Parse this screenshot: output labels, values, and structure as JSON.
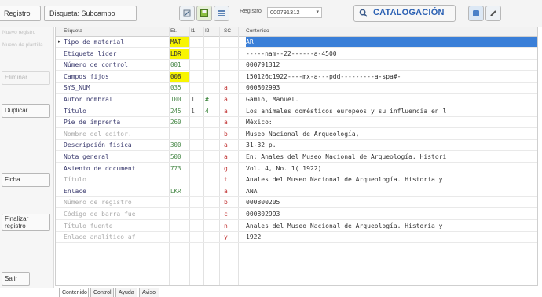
{
  "toolbar": {
    "registro_label": "Registro",
    "disquette_label": "Disqueta: Subcampo",
    "registro_select_label": "Registro",
    "registro_value": "000791312",
    "catalog_label": "CATALOGACIÓN"
  },
  "sidebar": {
    "nuevo_label": "Nuevo registro",
    "nuevo_de_label": "Nuevo de plantilla",
    "eliminar_label": "Eliminar",
    "duplicar_label": "Duplicar",
    "ficha_label": "Ficha",
    "finalizar_label": "Finalizar registro",
    "salir_label": "Salir"
  },
  "grid": {
    "headers": {
      "label": "Etiqueta",
      "et": "Et.",
      "i1": "I1",
      "i2": "I2",
      "sc": "SC",
      "content": "Contenido"
    },
    "rows": [
      {
        "label": "Tipo de material",
        "et": "MAT",
        "i1": "",
        "i2": "",
        "sc": "",
        "content": "AR"
      },
      {
        "label": "Etiqueta líder",
        "et": "LDR",
        "i1": "",
        "i2": "",
        "sc": "",
        "content": "-----nam--22------a-4500"
      },
      {
        "label": "Número de control",
        "et": "001",
        "i1": "",
        "i2": "",
        "sc": "",
        "content": "000791312"
      },
      {
        "label": "Campos fijos",
        "et": "008",
        "i1": "",
        "i2": "",
        "sc": "",
        "content": "150126c1922----mx-a---pdd---------a-spa#-"
      },
      {
        "label": "SYS_NUM",
        "et": "035",
        "i1": "",
        "i2": "",
        "sc": "a",
        "content": "000802993"
      },
      {
        "label": "Autor nombral",
        "et": "100",
        "i1": "1",
        "i2": "#",
        "sc": "a",
        "content": "Gamio, Manuel."
      },
      {
        "label": "Título",
        "et": "245",
        "i1": "1",
        "i2": "4",
        "sc": "a",
        "content": "Los animales domésticos europeos y su influencia en l"
      },
      {
        "label": "Pie de imprenta",
        "et": "260",
        "i1": "",
        "i2": "",
        "sc": "a",
        "content": "México:"
      },
      {
        "label": "Nombre del editor.",
        "et": "",
        "i1": "",
        "i2": "",
        "sc": "b",
        "content": "Museo Nacional de Arqueología,"
      },
      {
        "label": "Descripción física",
        "et": "300",
        "i1": "",
        "i2": "",
        "sc": "a",
        "content": "31-32 p."
      },
      {
        "label": "Nota general",
        "et": "500",
        "i1": "",
        "i2": "",
        "sc": "a",
        "content": "En: Anales del Museo Nacional de Arqueología, Histori"
      },
      {
        "label": "Asiento de document",
        "et": "773",
        "i1": "",
        "i2": "",
        "sc": "g",
        "content": "Vol. 4, No. 1( 1922)"
      },
      {
        "label": "Título",
        "et": "",
        "i1": "",
        "i2": "",
        "sc": "t",
        "content": "Anales del Museo Nacional de Arqueología. Historia y"
      },
      {
        "label": "Enlace",
        "et": "LKR",
        "i1": "",
        "i2": "",
        "sc": "a",
        "content": "ANA"
      },
      {
        "label": "Número de registro",
        "et": "",
        "i1": "",
        "i2": "",
        "sc": "b",
        "content": "000800205"
      },
      {
        "label": "Código de barra fue",
        "et": "",
        "i1": "",
        "i2": "",
        "sc": "c",
        "content": "000802993"
      },
      {
        "label": "Título fuente",
        "et": "",
        "i1": "",
        "i2": "",
        "sc": "n",
        "content": "Anales del Museo Nacional de Arqueología. Historia y"
      },
      {
        "label": "Enlace analítico af",
        "et": "",
        "i1": "",
        "i2": "",
        "sc": "y",
        "content": "1922"
      }
    ]
  },
  "tabs": [
    "Contenido",
    "Control",
    "Ayuda",
    "Aviso"
  ],
  "colors": {
    "selection": "#3a7fd8",
    "highlight": "#f8f500",
    "accent": "#2d62b4"
  }
}
